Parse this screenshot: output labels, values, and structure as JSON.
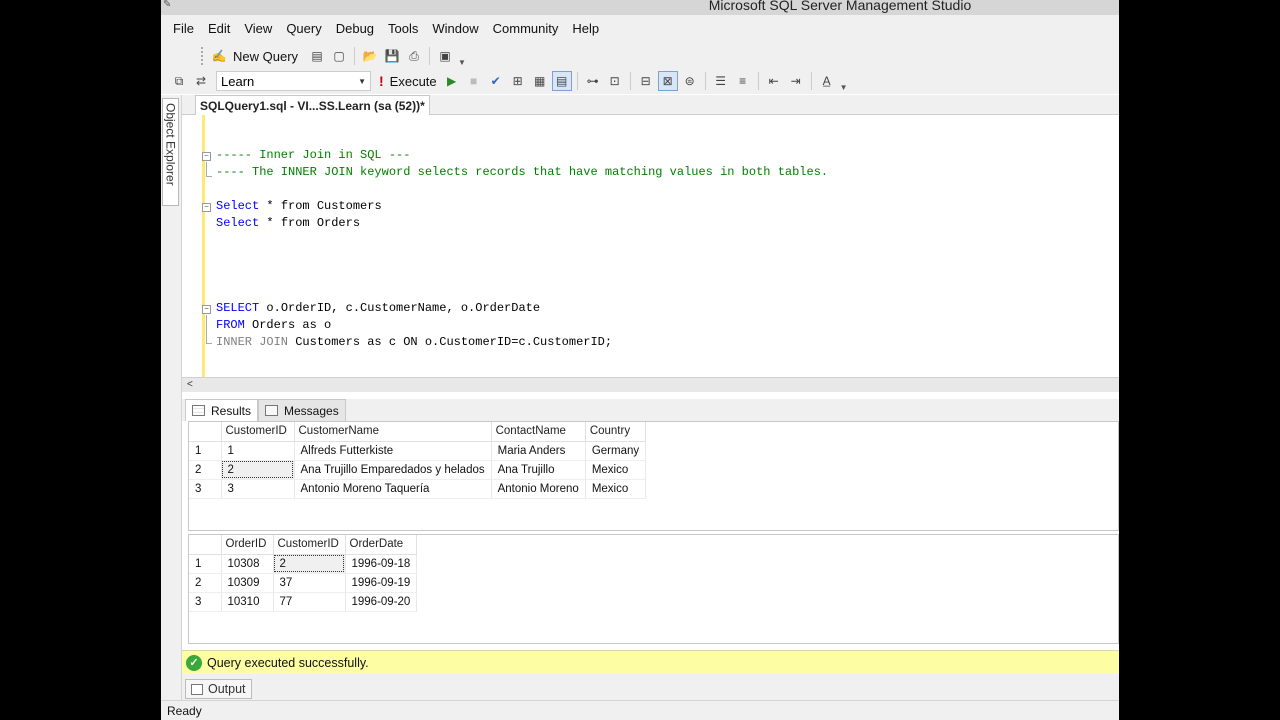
{
  "window": {
    "title": "Microsoft SQL Server Management Studio"
  },
  "menu": [
    "File",
    "Edit",
    "View",
    "Query",
    "Debug",
    "Tools",
    "Window",
    "Community",
    "Help"
  ],
  "toolbar1": {
    "new_query_label": "New Query"
  },
  "toolbar2": {
    "database": "Learn",
    "execute_label": "Execute"
  },
  "sidebar": {
    "object_explorer_label": "Object Explorer"
  },
  "document_tab": {
    "label": "SQLQuery1.sql - VI...SS.Learn (sa (52))*"
  },
  "editor": {
    "lines": {
      "comment1": "----- Inner Join in SQL ---",
      "comment2": "---- The INNER JOIN keyword selects records that have matching values in both tables.",
      "select1_kw": "Select",
      "select1_rest": " * from Customers",
      "select2_kw": "Select",
      "select2_rest": " * from Orders",
      "q1_kw": "SELECT",
      "q1_rest": " o.OrderID, c.CustomerName, o.OrderDate",
      "q2_kw": "FROM",
      "q2_rest": " Orders as o",
      "q3_kw": "INNER JOIN",
      "q3_rest": " Customers as c ON o.CustomerID=c.CustomerID;"
    }
  },
  "results_tabs": {
    "results_label": "Results",
    "messages_label": "Messages"
  },
  "grid1": {
    "columns": [
      "CustomerID",
      "CustomerName",
      "ContactName",
      "Country"
    ],
    "rows": [
      {
        "num": "1",
        "CustomerID": "1",
        "CustomerName": "Alfreds Futterkiste",
        "ContactName": "Maria Anders",
        "Country": "Germany"
      },
      {
        "num": "2",
        "CustomerID": "2",
        "CustomerName": "Ana Trujillo Emparedados y helados",
        "ContactName": "Ana Trujillo",
        "Country": "Mexico"
      },
      {
        "num": "3",
        "CustomerID": "3",
        "CustomerName": "Antonio Moreno Taquería",
        "ContactName": "Antonio Moreno",
        "Country": "Mexico"
      }
    ]
  },
  "grid2": {
    "columns": [
      "OrderID",
      "CustomerID",
      "OrderDate"
    ],
    "rows": [
      {
        "num": "1",
        "OrderID": "10308",
        "CustomerID": "2",
        "OrderDate": "1996-09-18"
      },
      {
        "num": "2",
        "OrderID": "10309",
        "CustomerID": "37",
        "OrderDate": "1996-09-19"
      },
      {
        "num": "3",
        "OrderID": "10310",
        "CustomerID": "77",
        "OrderDate": "1996-09-20"
      }
    ]
  },
  "exec_status": {
    "message": "Query executed successfully."
  },
  "output": {
    "label": "Output"
  },
  "statusbar": {
    "text": "Ready"
  },
  "colors": {
    "comment": "#008000",
    "keyword": "#0000ff",
    "success_bar": "#fdfda4"
  }
}
